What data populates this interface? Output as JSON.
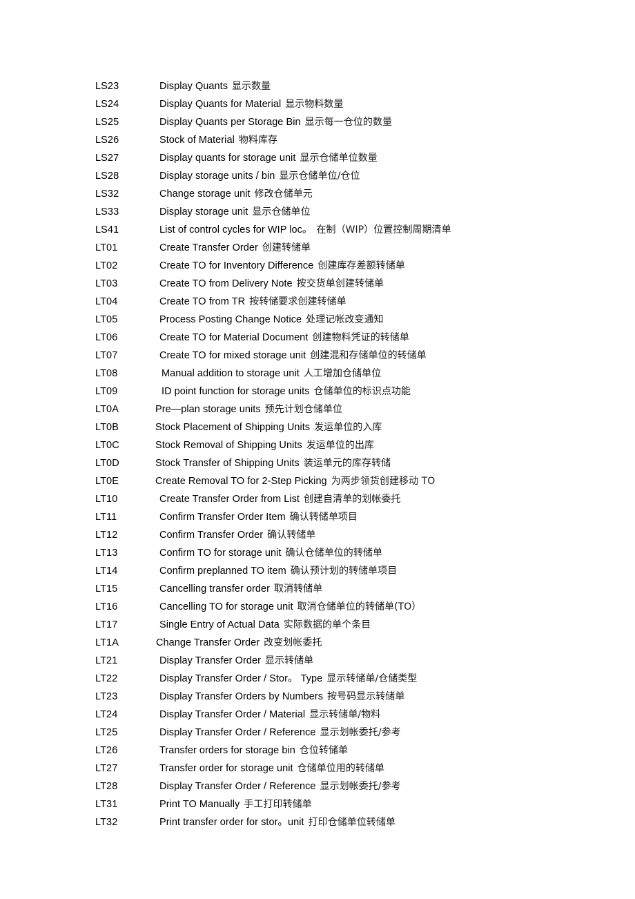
{
  "document": {
    "type": "transaction-code-reference-list",
    "background_color": "#ffffff",
    "text_color": "#000000"
  },
  "rows": [
    {
      "code": "LS23",
      "en": "Display Quants",
      "cn": "显示数量",
      "indent": 231
    },
    {
      "code": "LS24",
      "en": "Display Quants for Material",
      "cn": "显示物料数量",
      "indent": 231
    },
    {
      "code": "LS25",
      "en": "Display Quants per Storage Bin",
      "cn": "显示每一仓位的数量",
      "indent": 231
    },
    {
      "code": "LS26",
      "en": "Stock of Material",
      "cn": "物料库存",
      "indent": 231
    },
    {
      "code": "LS27",
      "en": "Display quants for storage unit",
      "cn": "显示仓储单位数量",
      "indent": 231
    },
    {
      "code": "LS28",
      "en": "Display storage units / bin",
      "cn": "显示仓储单位/仓位",
      "indent": 231
    },
    {
      "code": "LS32",
      "en": "Change storage unit",
      "cn": "修改仓储单元",
      "indent": 231
    },
    {
      "code": "LS33",
      "en": "Display storage unit",
      "cn": "显示仓储单位",
      "indent": 231
    },
    {
      "code": "LS41",
      "en": "List of control cycles for WIP loc。",
      "cn": "在制（WIP）位置控制周期清单",
      "indent": 231
    },
    {
      "code": "LT01",
      "en": "Create Transfer Order",
      "cn": "创建转储单",
      "indent": 231
    },
    {
      "code": "LT02",
      "en": "Create TO for Inventory Difference",
      "cn": "创建库存差额转储单",
      "indent": 231
    },
    {
      "code": "LT03",
      "en": "Create TO from Delivery Note",
      "cn": "按交货单创建转储单",
      "indent": 231
    },
    {
      "code": "LT04",
      "en": "Create TO from TR",
      "cn": "按转储要求创建转储单",
      "indent": 231
    },
    {
      "code": "LT05",
      "en": "Process Posting Change Notice",
      "cn": "处理记帐改变通知",
      "indent": 231
    },
    {
      "code": "LT06",
      "en": "Create TO for Material Document",
      "cn": "创建物料凭证的转储单",
      "indent": 231
    },
    {
      "code": "LT07",
      "en": "Create TO for mixed storage unit",
      "cn": "创建混和存储单位的转储单",
      "indent": 231
    },
    {
      "code": "LT08",
      "en": "Manual addition to storage unit",
      "cn": "人工增加仓储单位",
      "indent": 234
    },
    {
      "code": "LT09",
      "en": "ID point function for storage units",
      "cn": "仓储单位的标识点功能",
      "indent": 234
    },
    {
      "code": "LT0A",
      "en": "Pre—plan storage units",
      "cn": "预先计划仓储单位",
      "indent": 225
    },
    {
      "code": "LT0B",
      "en": "Stock Placement of Shipping Units",
      "cn": "发运单位的入库",
      "indent": 225
    },
    {
      "code": "LT0C",
      "en": "Stock Removal of Shipping Units",
      "cn": "发运单位的出库",
      "indent": 225
    },
    {
      "code": "LT0D",
      "en": "Stock Transfer of Shipping Units",
      "cn": "装运单元的库存转储",
      "indent": 225
    },
    {
      "code": "LT0E",
      "en": "Create Removal TO for 2-Step Picking",
      "cn": "为两步领货创建移动 TO",
      "indent": 225
    },
    {
      "code": "LT10",
      "en": "Create Transfer Order from List",
      "cn": "创建自清单的划帐委托",
      "indent": 231
    },
    {
      "code": "LT11",
      "en": "Confirm Transfer Order Item",
      "cn": "确认转储单项目",
      "indent": 231
    },
    {
      "code": "LT12",
      "en": "Confirm Transfer Order",
      "cn": "确认转储单",
      "indent": 231
    },
    {
      "code": "LT13",
      "en": "Confirm TO for storage unit",
      "cn": "确认仓储单位的转储单",
      "indent": 231
    },
    {
      "code": "LT14",
      "en": "Confirm preplanned TO item",
      "cn": "确认预计划的转储单项目",
      "indent": 231
    },
    {
      "code": "LT15",
      "en": "Cancelling transfer order",
      "cn": "取消转储单",
      "indent": 231
    },
    {
      "code": "LT16",
      "en": "Cancelling TO for storage unit",
      "cn": "取消仓储单位的转储单(TO）",
      "indent": 231
    },
    {
      "code": "LT17",
      "en": "Single Entry of Actual Data",
      "cn": "实际数据的单个条目",
      "indent": 231
    },
    {
      "code": "LT1A",
      "en": "Change Transfer Order",
      "cn": "改变划帐委托",
      "indent": 226
    },
    {
      "code": "LT21",
      "en": "Display Transfer Order",
      "cn": "显示转储单",
      "indent": 231
    },
    {
      "code": "LT22",
      "en": "Display Transfer Order / Stor。  Type",
      "cn": "显示转储单/仓储类型",
      "indent": 231
    },
    {
      "code": "LT23",
      "en": "Display Transfer Orders by Numbers",
      "cn": "按号码显示转储单",
      "indent": 231
    },
    {
      "code": "LT24",
      "en": "Display Transfer Order / Material",
      "cn": "显示转储单/物料",
      "indent": 231
    },
    {
      "code": "LT25",
      "en": "Display Transfer Order / Reference",
      "cn": "显示划帐委托/参考",
      "indent": 231
    },
    {
      "code": "LT26",
      "en": "Transfer orders for storage bin",
      "cn": "仓位转储单",
      "indent": 231
    },
    {
      "code": "LT27",
      "en": "Transfer order for storage unit",
      "cn": "仓储单位用的转储单",
      "indent": 231
    },
    {
      "code": "LT28",
      "en": "Display Transfer Order / Reference",
      "cn": "显示划帐委托/参考",
      "indent": 231
    },
    {
      "code": "LT31",
      "en": "Print TO Manually",
      "cn": "手工打印转储单",
      "indent": 231
    },
    {
      "code": "LT32",
      "en": "Print transfer order for stor。unit",
      "cn": "打印仓储单位转储单",
      "indent": 231
    }
  ]
}
